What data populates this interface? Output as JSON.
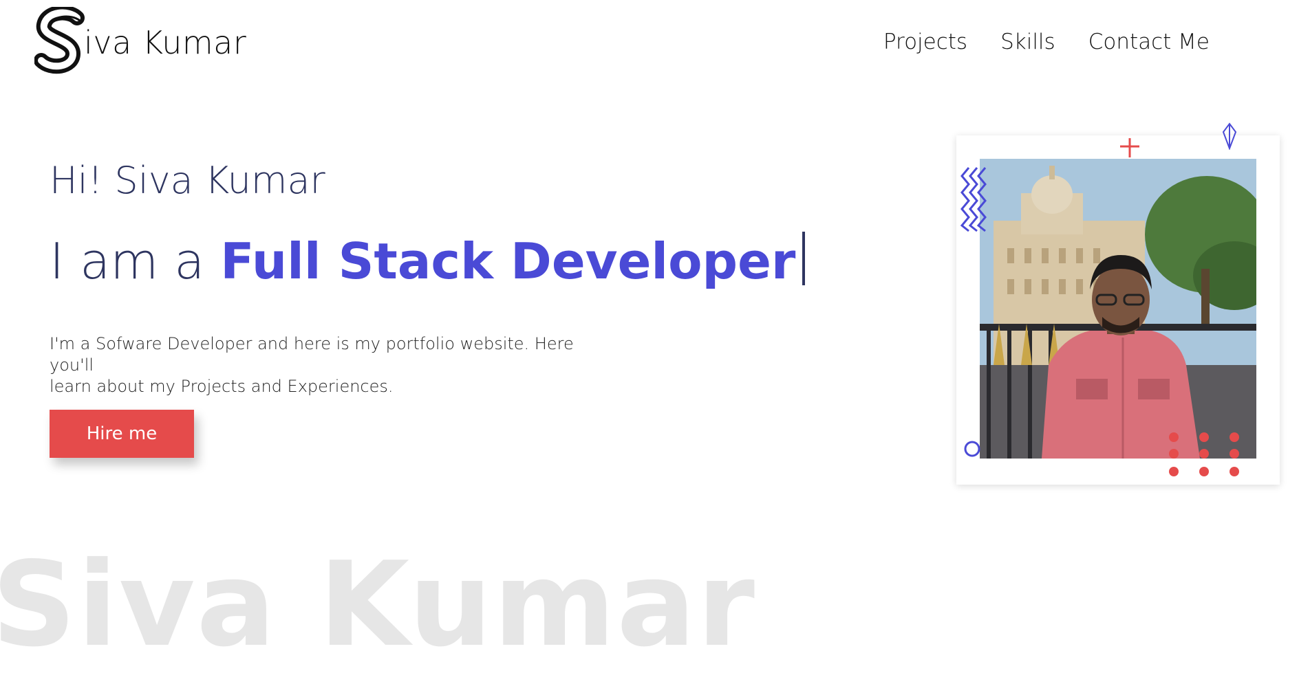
{
  "brand": {
    "name_rest": "iva Kumar"
  },
  "nav": {
    "items": [
      {
        "label": "Projects"
      },
      {
        "label": "Skills"
      },
      {
        "label": "Contact Me"
      }
    ]
  },
  "hero": {
    "greeting": "Hi! Siva Kumar",
    "role_prefix": "I am a",
    "role_title": "Full Stack Developer",
    "intro_line1": "I'm a Sofware Developer and here is my portfolio website. Here you'll",
    "intro_line2": "learn about my Projects and Experiences.",
    "cta_label": "Hire me"
  },
  "watermark": {
    "text": "Siva Kumar"
  },
  "colors": {
    "accent": "#4a4ad6",
    "heading": "#2e3560",
    "cta": "#e54b4b"
  },
  "icons": [
    "logo-s-icon",
    "plus-icon",
    "gem-icon",
    "zigzag-icon",
    "circle-icon",
    "dots-grid-icon"
  ]
}
